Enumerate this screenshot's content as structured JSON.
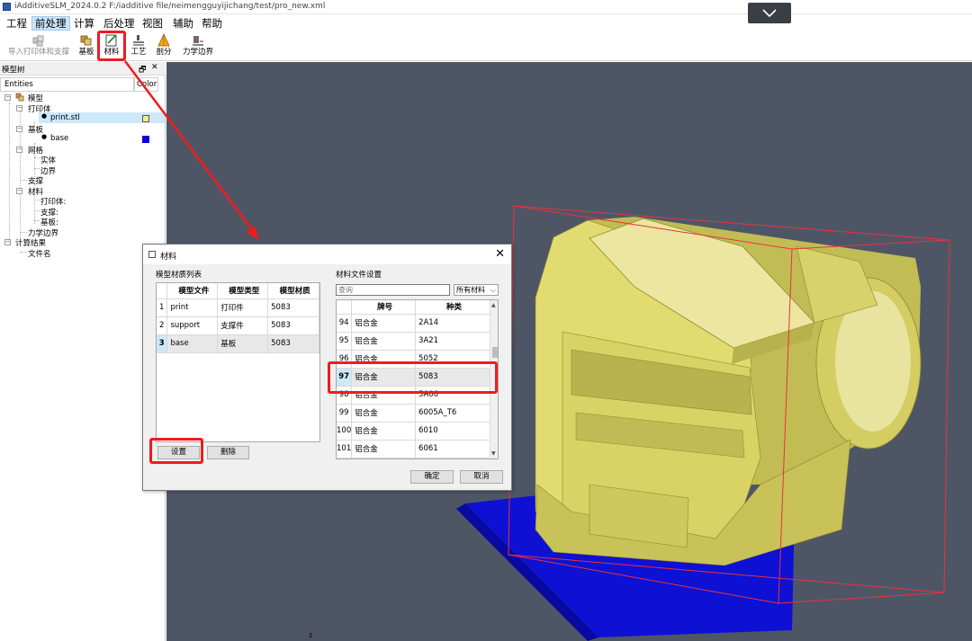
{
  "window": {
    "title": "iAdditiveSLM_2024.0.2 F:/iadditive file/neimengguyijichang/test/pro_new.xml"
  },
  "menu": {
    "items": [
      "工程",
      "前处理",
      "计算",
      "后处理",
      "视图",
      "辅助",
      "帮助"
    ],
    "active": "前处理"
  },
  "toolbar": {
    "import_label": "导入打印体和支撑",
    "baseplate_label": "基板",
    "material_label": "材料",
    "process_label": "工艺",
    "mesh_label": "剖分",
    "boundary_label": "力学边界"
  },
  "model_tree": {
    "title": "模型树",
    "float_glyph": "🗗",
    "close_glyph": "✕",
    "col_entities": "Entities",
    "col_color": "Color",
    "items": {
      "model": "模型",
      "print_body": "打印体",
      "print_stl": "print.stl",
      "substrate": "基板",
      "base": "base",
      "mesh": "网格",
      "solid": "实体",
      "boundary": "边界",
      "support": "支撑",
      "material": "材料",
      "mat_print": "打印体:",
      "mat_support": "支撑:",
      "mat_base": "基板:",
      "mech_boundary": "力学边界",
      "results": "计算结果",
      "filename": "文件名"
    },
    "colors": {
      "print_stl": "#f4f08a",
      "base": "#0000e0"
    }
  },
  "dialog": {
    "title": "材料",
    "close_glyph": "✕",
    "left_section": "模型材质列表",
    "left_headers": [
      "模型文件",
      "模型类型",
      "模型材质"
    ],
    "left_rows": [
      {
        "n": "1",
        "file": "print",
        "type": "打印件",
        "material": "5083"
      },
      {
        "n": "2",
        "file": "support",
        "type": "支撑件",
        "material": "5083"
      },
      {
        "n": "3",
        "file": "base",
        "type": "基板",
        "material": "5083"
      }
    ],
    "set_button": "设置",
    "delete_button": "删除",
    "right_section": "材料文件设置",
    "search_placeholder": "查询",
    "filter_value": "所有材料",
    "filter_chevron": "⌵",
    "right_headers": [
      "牌号",
      "种类"
    ],
    "right_rows": [
      {
        "n": "94",
        "grade": "铝合金",
        "kind": "2A14"
      },
      {
        "n": "95",
        "grade": "铝合金",
        "kind": "3A21"
      },
      {
        "n": "96",
        "grade": "铝合金",
        "kind": "5052"
      },
      {
        "n": "97",
        "grade": "铝合金",
        "kind": "5083"
      },
      {
        "n": "98",
        "grade": "铝合金",
        "kind": "5A06"
      },
      {
        "n": "99",
        "grade": "铝合金",
        "kind": "6005A_T6"
      },
      {
        "n": "100",
        "grade": "铝合金",
        "kind": "6010"
      },
      {
        "n": "101",
        "grade": "铝合金",
        "kind": "6061"
      }
    ],
    "scroll_up": "▲",
    "scroll_down": "▼",
    "ok_button": "确定",
    "cancel_button": "取消"
  },
  "viewport": {
    "background": "#4e5666",
    "part_color": "#d8d26a",
    "plate_color": "#0e10d4",
    "bbox_color": "#e8323c"
  },
  "annotation_color": "#f21b1b",
  "status_mark": "z"
}
